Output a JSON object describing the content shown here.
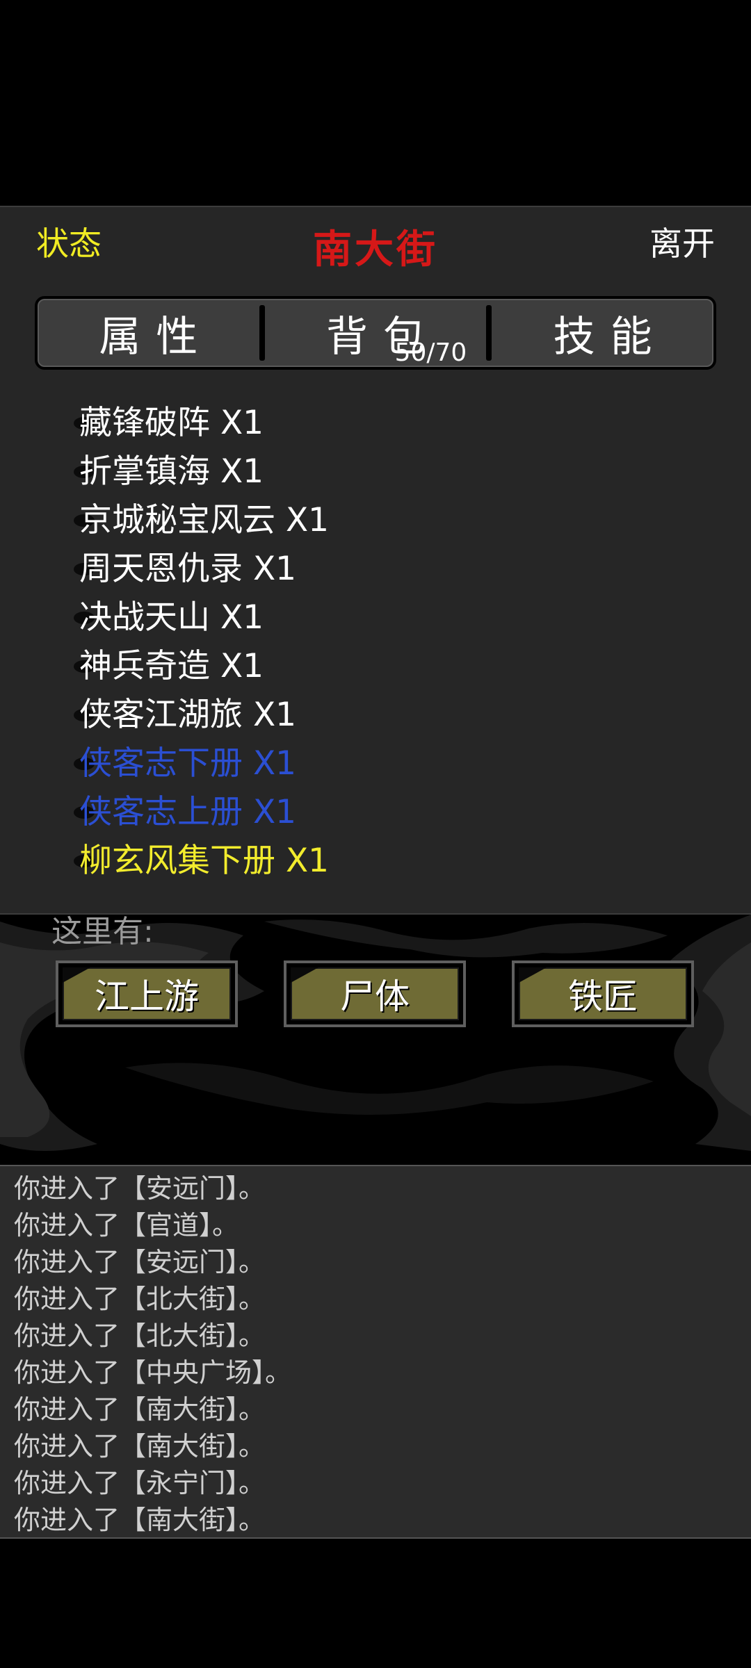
{
  "header": {
    "status_label": "状态",
    "location_title": "南大街",
    "leave_label": "离开"
  },
  "tabs": [
    {
      "label": "属性"
    },
    {
      "label": "背包",
      "count": "50/70"
    },
    {
      "label": "技能"
    }
  ],
  "inventory": [
    {
      "name": "藏锋破阵 X1",
      "color": "#ffffff"
    },
    {
      "name": "折掌镇海 X1",
      "color": "#ffffff"
    },
    {
      "name": "京城秘宝风云 X1",
      "color": "#ffffff"
    },
    {
      "name": "周天恩仇录 X1",
      "color": "#ffffff"
    },
    {
      "name": "决战天山 X1",
      "color": "#ffffff"
    },
    {
      "name": "神兵奇造 X1",
      "color": "#ffffff"
    },
    {
      "name": "侠客江湖旅 X1",
      "color": "#ffffff"
    },
    {
      "name": "侠客志下册 X1",
      "color": "#2b4fd3"
    },
    {
      "name": "侠客志上册 X1",
      "color": "#2b4fd3"
    },
    {
      "name": "柳玄风集下册 X1",
      "color": "#f2ec2d"
    }
  ],
  "here": {
    "label": "这里有:",
    "entities": [
      "江上游",
      "尸体",
      "铁匠"
    ]
  },
  "log": [
    "你进入了【安远门】。",
    "你进入了【官道】。",
    "你进入了【安远门】。",
    "你进入了【北大街】。",
    "你进入了【北大街】。",
    "你进入了【中央广场】。",
    "你进入了【南大街】。",
    "你进入了【南大街】。",
    "你进入了【永宁门】。",
    "你进入了【南大街】。"
  ],
  "colors": {
    "title_red": "#d61818",
    "status_yellow": "#f1ec23",
    "rare_blue": "#2b4fd3",
    "epic_yellow": "#f2ec2d",
    "button_olive": "#6f6b35"
  }
}
